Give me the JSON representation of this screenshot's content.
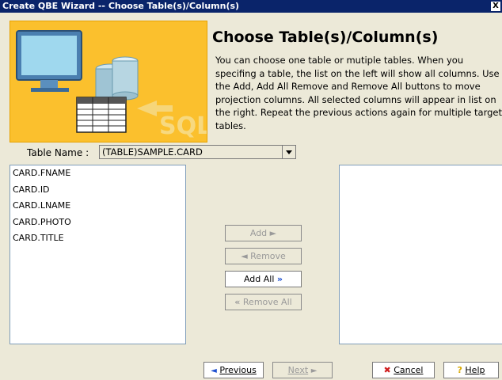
{
  "window": {
    "title": "Create QBE Wizard -- Choose Table(s)/Column(s)",
    "close_glyph": "X"
  },
  "header": {
    "title": "Choose Table(s)/Column(s)",
    "description": "You can choose one table or mutiple tables. When you specifing a table, the list on the left will show all columns. Use the Add, Add All Remove and Remove All buttons to move projection columns. All selected columns will appear in list on the right. Repeat the previous actions again for multiple target tables.",
    "banner_text": "SQL"
  },
  "table_name": {
    "label": "Table Name :",
    "value": "(TABLE)SAMPLE.CARD"
  },
  "columns": [
    "CARD.FNAME",
    "CARD.ID",
    "CARD.LNAME",
    "CARD.PHOTO",
    "CARD.TITLE"
  ],
  "selected_columns": [],
  "buttons": {
    "add": "Add",
    "remove": "Remove",
    "add_all": "Add All",
    "remove_all": "Remove All"
  },
  "footer": {
    "previous": "Previous",
    "next": "Next",
    "cancel": "Cancel",
    "help": "Help"
  },
  "colors": {
    "title_bar": "#0a246a",
    "banner": "#fbc02d",
    "background": "#ece9d8"
  }
}
